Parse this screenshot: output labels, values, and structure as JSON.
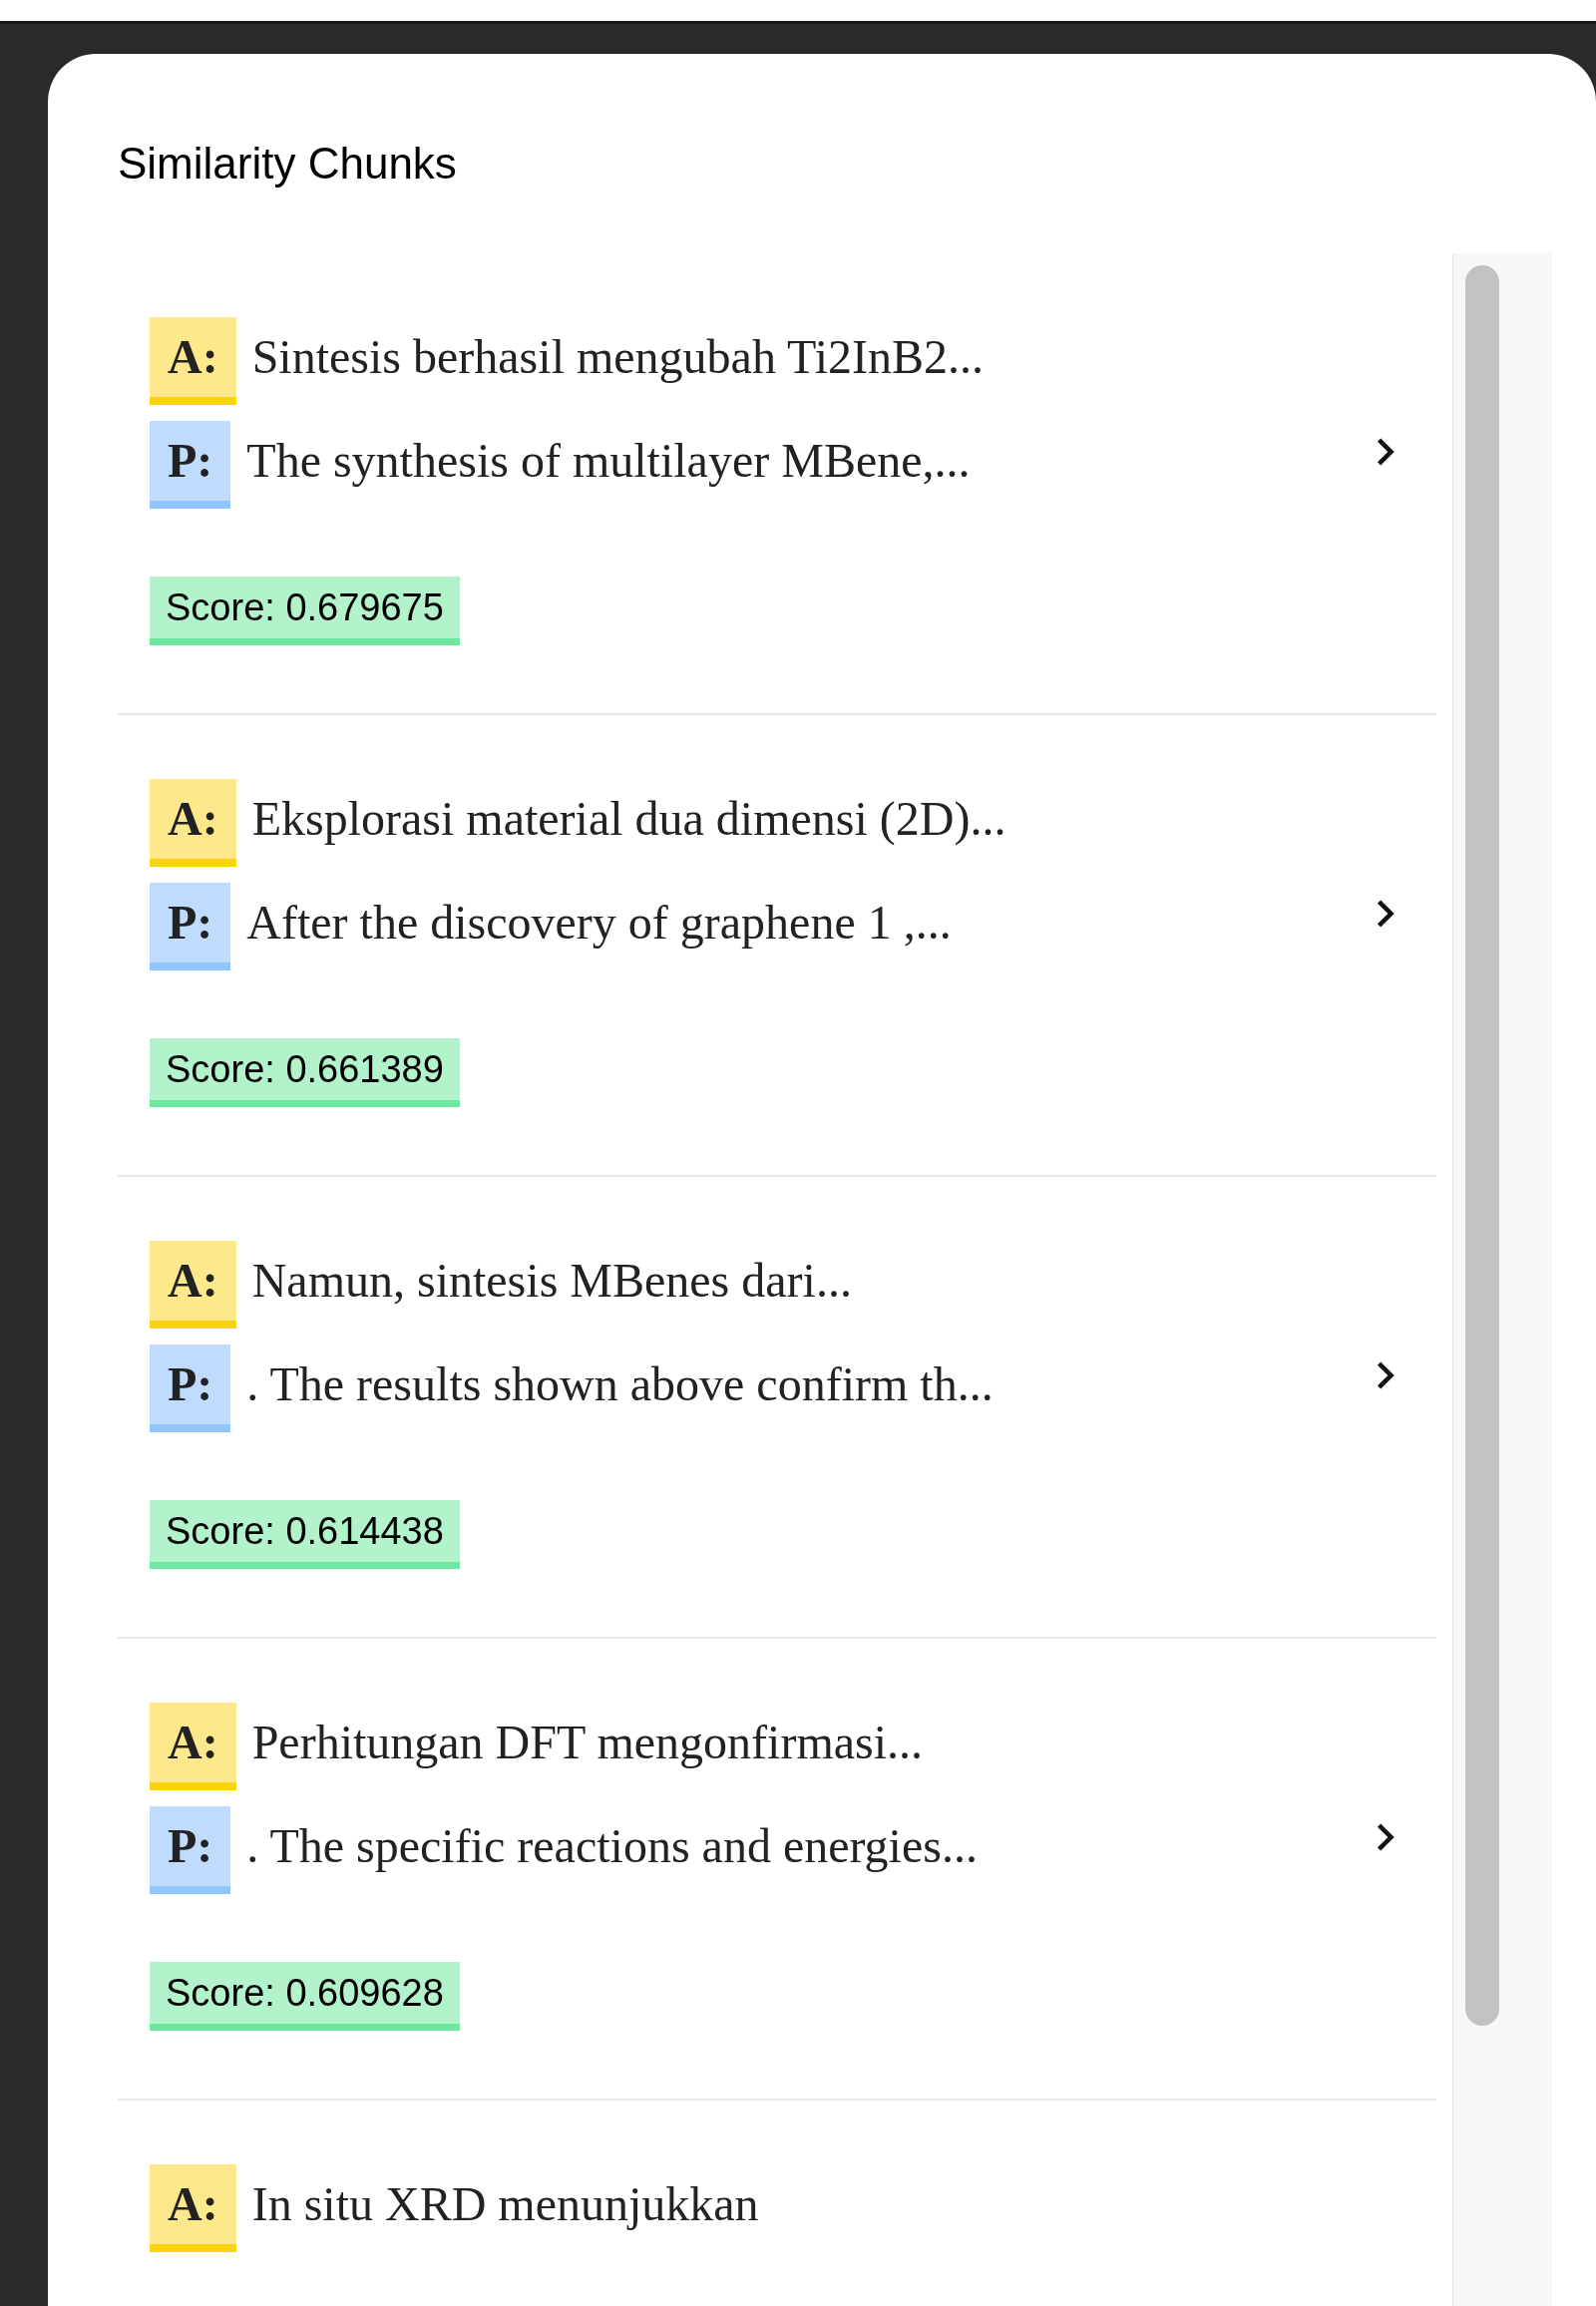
{
  "panel": {
    "title": "Similarity Chunks"
  },
  "chunks": [
    {
      "answer_label": "A:",
      "answer": "Sintesis berhasil mengubah Ti2InB2...",
      "passage_label": "P:",
      "passage": "The synthesis of multilayer MBene,...",
      "score": "Score: 0.679675"
    },
    {
      "answer_label": "A:",
      "answer": "Eksplorasi material dua dimensi (2D)...",
      "passage_label": "P:",
      "passage": "After the discovery of graphene 1 ,...",
      "score": "Score: 0.661389"
    },
    {
      "answer_label": "A:",
      "answer": "Namun, sintesis MBenes dari...",
      "passage_label": "P:",
      "passage": ". The results shown above confirm th...",
      "score": "Score: 0.614438"
    },
    {
      "answer_label": "A:",
      "answer": "Perhitungan DFT mengonfirmasi...",
      "passage_label": "P:",
      "passage": ". The specific reactions and energies...",
      "score": "Score: 0.609628"
    },
    {
      "answer_label": "A:",
      "answer": "In situ XRD menunjukkan"
    }
  ]
}
